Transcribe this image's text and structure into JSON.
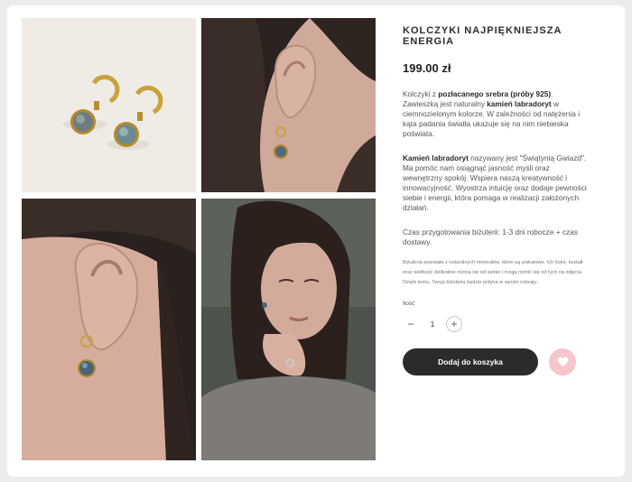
{
  "product": {
    "title": "KOLCZYKI NAJPIĘKNIEJSZA ENERGIA",
    "price": "199.00 zł",
    "desc1": [
      {
        "t": "Kolczyki z ",
        "b": false
      },
      {
        "t": "pozłacanego srebra (próby 925)",
        "b": true
      },
      {
        "t": ". Zawieszką jest naturalny ",
        "b": false
      },
      {
        "t": "kamień labradoryt",
        "b": true
      },
      {
        "t": " w ciemnozielonym kolorze. W zależności od natężenia i kąta padania światła ukazuje się na nim niebieska poświata.",
        "b": false
      }
    ],
    "desc2": [
      {
        "t": "Kamień labradoryt",
        "b": true
      },
      {
        "t": " nazywany jest \"Świątynią Gwiazd\". Ma pomóc nam osiągnąć jasność myśli oraz wewnętrzny spokój. Wspiera naszą kreatywność i innowacyjność. Wyostrza intuicję oraz dodaje pewności siebie i energii, która pomaga w realizacji założonych działań.",
        "b": false
      }
    ],
    "production_time": "Czas przygotowania biżuterii: 1-3 dni robocze + czas dostawy.",
    "note": "Biżuteria powstała z naturalnych minerałów, które są unikatowe. Ich kolor, kształt oraz wielkość delikatnie różnią się od siebie i mogą różnić się od tych na zdjęciu. Dzięki temu, Twoja biżuteria będzie jedyna w swoim rodzaju."
  },
  "quantity": {
    "label": "Ilość",
    "value": "1",
    "minus": "−",
    "plus": "+"
  },
  "cart": {
    "add_label": "Dodaj do koszyka"
  },
  "colors": {
    "button": "#2b2b2b",
    "wishlist": "#f6c6cc"
  }
}
